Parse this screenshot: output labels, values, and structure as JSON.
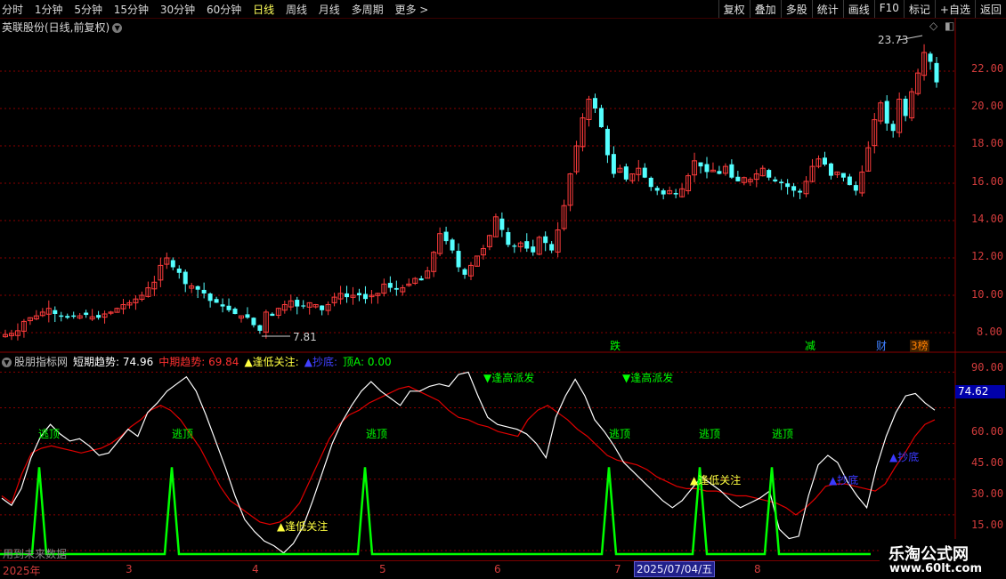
{
  "toolbar": {
    "periods": [
      "分时",
      "1分钟",
      "5分钟",
      "15分钟",
      "30分钟",
      "60分钟",
      "日线",
      "周线",
      "月线",
      "多周期",
      "更多 >"
    ],
    "active_period": "日线",
    "right_tools": [
      "复权",
      "叠加",
      "多股",
      "统计",
      "画线",
      "F10",
      "标记",
      "+自选",
      "返回"
    ]
  },
  "stock_title": "英联股份(日线,前复权)",
  "indicator": {
    "name": "股朋指标网",
    "short_label": "短期趋势: 74.96",
    "mid_label": "中期趋势: 69.84",
    "low_label": "▲逢低关注:",
    "bottom_label": "▲抄底:",
    "top_label": "顶A: 0.00",
    "current_value": "74.62"
  },
  "price_axis": [
    "22.00",
    "20.00",
    "18.00",
    "16.00",
    "14.00",
    "12.00",
    "10.00",
    "8.00"
  ],
  "indicator_axis": [
    "90.00",
    "75.00",
    "60.00",
    "45.00",
    "30.00",
    "15.00"
  ],
  "x_axis": [
    "2025年",
    "3",
    "4",
    "5",
    "6",
    "7",
    "8"
  ],
  "selected_date": "2025/07/04/五",
  "annotations": {
    "high_price": "23.73",
    "low_price": "7.81",
    "escape_top": "逃顶",
    "buy_low": "▲逢低关注",
    "high_sell": "▼逢高派发",
    "bottom_buy": "▲抄底"
  },
  "event_tags": [
    "跌",
    "减",
    "财",
    "3榜"
  ],
  "footer_note": "用到未来数据",
  "watermark": {
    "name": "乐淘公式网",
    "url": "www.60lt.com"
  },
  "colors": {
    "up": "#ff3c3c",
    "down": "#54ffff",
    "short_line": "#ffffff",
    "mid_line": "#e00000",
    "signal": "#00ff00",
    "grid": "#8a0000"
  },
  "chart_data": {
    "type": "candlestick",
    "closes": [
      7.9,
      7.95,
      8.1,
      8.6,
      8.8,
      8.9,
      9.1,
      9.3,
      9.0,
      8.85,
      8.8,
      8.85,
      8.9,
      8.95,
      8.85,
      8.8,
      9.0,
      9.1,
      9.3,
      9.5,
      9.6,
      9.8,
      10.0,
      10.4,
      10.7,
      11.6,
      12.0,
      11.5,
      11.2,
      10.6,
      10.5,
      10.3,
      10.1,
      9.7,
      9.6,
      9.4,
      9.2,
      9.0,
      8.9,
      8.8,
      8.4,
      8.1,
      9.1,
      8.9,
      9.3,
      9.5,
      9.7,
      9.4,
      9.4,
      9.6,
      9.5,
      9.2,
      9.5,
      9.9,
      10.1,
      9.9,
      10.0,
      10.0,
      9.8,
      10.0,
      10.1,
      10.6,
      10.4,
      10.3,
      10.4,
      10.6,
      10.9,
      10.8,
      11.3,
      12.3,
      13.3,
      12.9,
      12.4,
      11.5,
      11.1,
      11.6,
      12.1,
      12.5,
      13.2,
      14.2,
      13.5,
      12.7,
      12.6,
      12.8,
      12.5,
      12.3,
      13.1,
      12.8,
      12.4,
      13.5,
      14.8,
      16.5,
      18.0,
      19.5,
      20.5,
      20.0,
      19.0,
      17.5,
      16.5,
      16.8,
      16.2,
      16.5,
      16.8,
      16.3,
      15.8,
      15.6,
      15.4,
      15.6,
      15.4,
      15.7,
      16.4,
      17.2,
      16.9,
      16.6,
      16.7,
      16.5,
      16.9,
      16.3,
      16.1,
      16.3,
      16.2,
      16.5,
      16.8,
      16.3,
      16.1,
      16.0,
      15.8,
      15.6,
      15.5,
      16.1,
      16.9,
      17.3,
      17.0,
      16.4,
      16.6,
      16.3,
      15.9,
      15.6,
      16.6,
      17.9,
      19.4,
      20.3,
      19.2,
      18.8,
      20.5,
      19.6,
      20.9,
      21.9,
      23.0,
      22.5,
      21.4
    ],
    "price_ylim": [
      7.0,
      24.0
    ],
    "price_high": 23.73,
    "price_low": 7.81,
    "short_trend": [
      37,
      34,
      41,
      54,
      63,
      68,
      64,
      61,
      62,
      59,
      55,
      56,
      61,
      66,
      63,
      73,
      77,
      82,
      85,
      88,
      82,
      72,
      61,
      50,
      38,
      28,
      23,
      19,
      17,
      14,
      18,
      25,
      36,
      48,
      60,
      69,
      76,
      82,
      86,
      82,
      79,
      76,
      82,
      82,
      84,
      85,
      84,
      89,
      90,
      80,
      71,
      68,
      67,
      66,
      64,
      60,
      54,
      71,
      80,
      87,
      80,
      70,
      65,
      59,
      52,
      48,
      44,
      40,
      36,
      33,
      36,
      41,
      46,
      43,
      40,
      36,
      33,
      35,
      37,
      40,
      24,
      20,
      21,
      38,
      51,
      55,
      52,
      44,
      38,
      33,
      50,
      63,
      73,
      80,
      81,
      77,
      74
    ],
    "mid_trend": [
      38,
      35,
      47,
      56,
      58,
      59,
      58,
      57,
      56,
      57,
      58,
      60,
      63,
      67,
      70,
      74,
      76,
      74,
      70,
      64,
      58,
      50,
      42,
      36,
      33,
      30,
      27,
      26,
      27,
      30,
      35,
      44,
      53,
      62,
      68,
      72,
      74,
      77,
      79,
      81,
      83,
      84,
      82,
      80,
      78,
      74,
      71,
      70,
      68,
      67,
      65,
      64,
      63,
      70,
      74,
      76,
      73,
      70,
      66,
      63,
      59,
      55,
      53,
      52,
      51,
      49,
      46,
      44,
      42,
      41,
      41,
      40,
      40,
      39,
      38,
      38,
      37,
      36,
      35,
      33,
      30,
      33,
      37,
      42,
      43,
      43,
      42,
      41,
      40,
      43,
      50,
      56,
      63,
      68,
      70
    ],
    "indicator_ylim": [
      12,
      95
    ],
    "escape_top_signal_value": 50
  }
}
